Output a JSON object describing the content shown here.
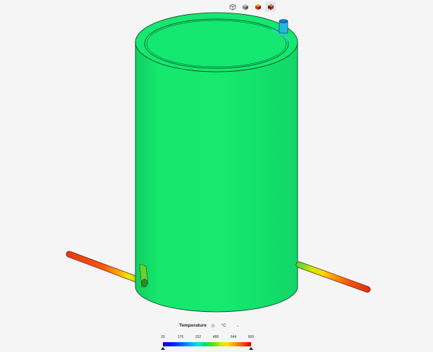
{
  "toolbar": {
    "buttons": [
      {
        "icon": "wireframe-cube-icon",
        "active": false
      },
      {
        "icon": "solid-cube-icon",
        "active": false
      },
      {
        "icon": "colored-cube-icon",
        "active": false
      },
      {
        "icon": "colored-mesh-cube-icon",
        "active": true
      }
    ]
  },
  "legend": {
    "title": "Temperature",
    "info_icon": "info-icon",
    "unit": "°C",
    "unit_dropdown_icon": "chevron-down-icon",
    "ticks": [
      "20",
      "176",
      "332",
      "488",
      "644",
      "800"
    ],
    "min_value": 20,
    "max_value": 800
  },
  "scene": {
    "colors": {
      "tank_body": "#16e06c",
      "tank_top": "#14e870",
      "pipe_hot": "#e8250c",
      "pipe_mid": "#ffd400",
      "pipe_cool": "#16e06c",
      "nozzle": "#26c3e8"
    }
  }
}
